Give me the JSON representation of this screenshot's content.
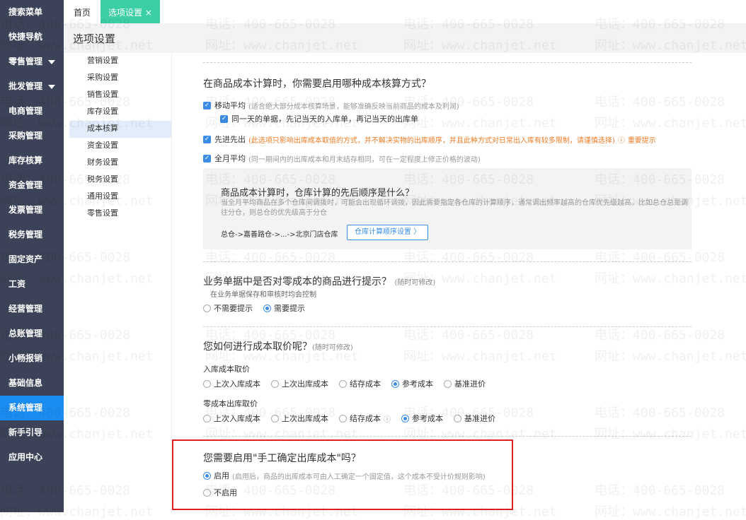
{
  "sidebar": {
    "items": [
      "搜索菜单",
      "快捷导航",
      "零售管理",
      "批发管理",
      "电商管理",
      "采购管理",
      "库存核算",
      "资金管理",
      "发票管理",
      "税务管理",
      "固定资产",
      "工资",
      "经营管理",
      "总账管理",
      "小畅报销",
      "基础信息",
      "系统管理",
      "新手引导",
      "应用中心"
    ],
    "active": "系统管理"
  },
  "tabs": {
    "home": "首页",
    "options": "选项设置",
    "close": "×"
  },
  "page_title": "选项设置",
  "subnav": {
    "items": [
      "营销设置",
      "采购设置",
      "销售设置",
      "库存设置",
      "成本核算",
      "资金设置",
      "财务设置",
      "税务设置",
      "通用设置",
      "零售设置"
    ],
    "active": "成本核算"
  },
  "cost_method": {
    "question": "在商品成本计算时，你需要启用哪种成本核算方式？",
    "moving": {
      "label": "移动平均",
      "note": "(适合绝大部分成本核算场景，能够准确反映当前商品的成本及利润)",
      "checked": true
    },
    "same_day": {
      "label": "同一天的单据，先记当天的入库单，再记当天的出库单",
      "checked": true
    },
    "fifo": {
      "label": "先进先出",
      "note": "(此选项只影响出库成本取值的方式，并不解决实物的出库顺序，并且此种方式对日常出入库有较多限制，请谨慎选择)",
      "tip": "重要提示",
      "checked": true
    },
    "monthly": {
      "label": "全月平均",
      "note": "(同一期间内的出库成本和月末结存相同，可在一定程度上修正价格的波动)",
      "checked": true
    }
  },
  "order": {
    "title": "商品成本计算时，仓库计算的先后顺序是什么？",
    "desc": "当全月平均商品在多个仓库间调拨时，可能会出现循环调拨，因此需要指定各仓库的计算顺序，通常调出频率越高的仓库优先级越高。比如总仓总是调往分仓，则总仓的优先级高于分仓",
    "path": "总仓->嘉善路仓->...->北京门店仓库",
    "button": "仓库计算顺序设置 〉"
  },
  "zero_cost": {
    "question": "业务单据中是否对零成本的商品进行提示？",
    "hint": "(随时可修改)",
    "sub": "在业务单据保存和审核时均会控制",
    "options": [
      "不需要提示",
      "需要提示"
    ],
    "selected": 1
  },
  "cost_take": {
    "question": "您如何进行成本取价呢？",
    "hint": "(随时可修改)",
    "in_label": "入库成本取价",
    "in_options": [
      "上次入库成本",
      "上次出库成本",
      "结存成本",
      "参考成本",
      "基准进价"
    ],
    "in_selected": 3,
    "out_label": "零成本出库取价",
    "out_options": [
      "上次入库成本",
      "上次出库成本",
      "结存成本",
      "参考成本",
      "基准进价"
    ],
    "out_selected": 3
  },
  "manual": {
    "question": "您需要启用\"手工确定出库成本\"吗？",
    "enable": "启用",
    "enable_note": "(启用后，商品的出库成本可由人工确定一个固定值，这个成本不受计价规则影响)",
    "disable": "不启用",
    "selected": 0
  },
  "watermark": {
    "phone": "电话：400-665-0028",
    "site": "网址：www.chanjet.net"
  },
  "colors": {
    "sidebar": "#3c4257",
    "active": "#1b8cf2",
    "tab": "#3ccea5",
    "warn": "#f07b25",
    "highlight": "#e02020"
  }
}
